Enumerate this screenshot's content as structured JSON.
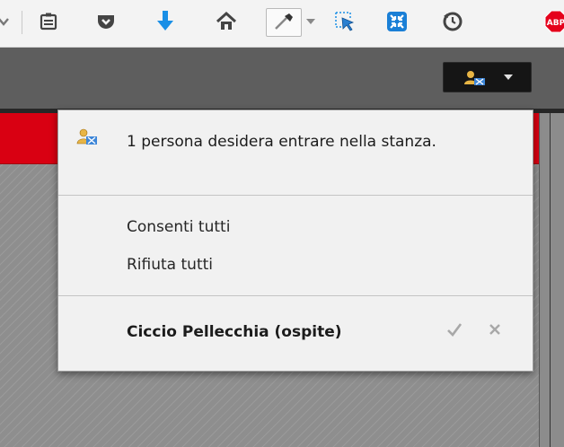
{
  "browser_toolbar": {
    "icons": [
      "chevron-down-icon",
      "reader-icon",
      "pocket-icon",
      "download-icon",
      "home-icon",
      "eyedropper-icon",
      "dropdown-arrow-icon",
      "element-picker-icon",
      "shrink-icon",
      "history-icon",
      "adblock-icon"
    ],
    "adblock_label": "ABP"
  },
  "header": {
    "attendee_button": {
      "icon": "attendee-request-icon",
      "dropdown": "chevron-down-icon"
    }
  },
  "popup": {
    "message": "1 persona desidera entrare nella stanza.",
    "message_icon": "attendee-request-icon",
    "actions": {
      "allow_all": "Consenti tutti",
      "deny_all": "Rifiuta tutti"
    },
    "requests": [
      {
        "name": "Ciccio Pellecchia (ospite)",
        "accept_icon": "checkmark-icon",
        "reject_icon": "close-icon"
      }
    ]
  },
  "colors": {
    "header": "#5e5e5e",
    "red_bar": "#d90012",
    "popup_bg": "#f1f1f1",
    "download_blue": "#1a8fe6",
    "adblock_red": "#e5001b"
  }
}
